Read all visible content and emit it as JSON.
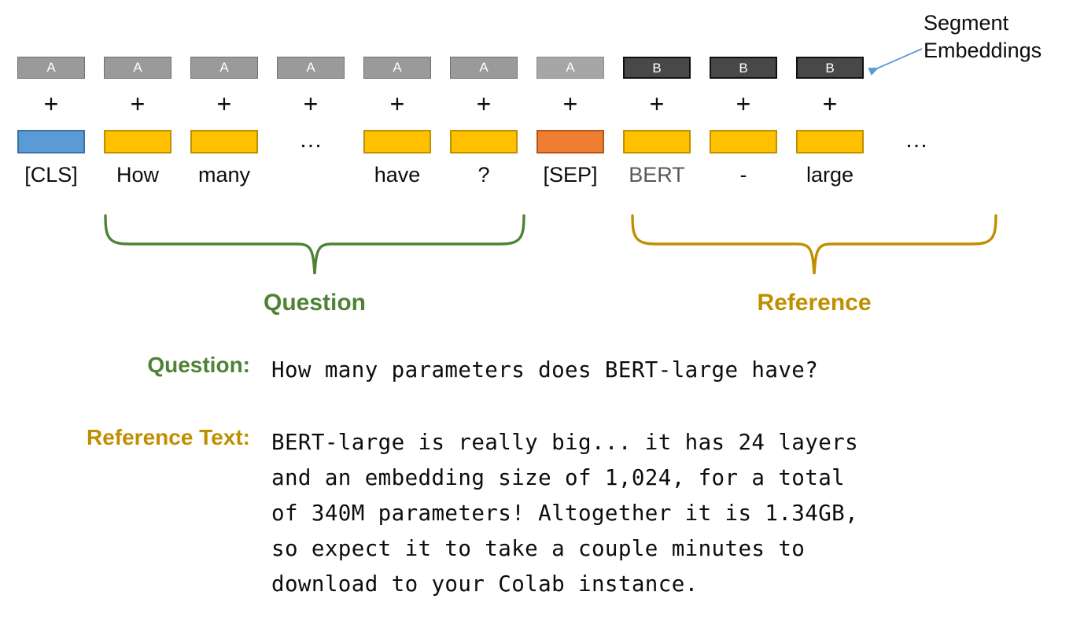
{
  "diagram": {
    "columns": [
      {
        "segment": "A",
        "segment_style": "a",
        "plus": "+",
        "embedding_color": "#5b9bd5",
        "embedding_kind": "blue",
        "token": "[CLS]",
        "token_style": "normal"
      },
      {
        "segment": "A",
        "segment_style": "a",
        "plus": "+",
        "embedding_color": "#ffc000",
        "embedding_kind": "yellow",
        "token": "How",
        "token_style": "normal"
      },
      {
        "segment": "A",
        "segment_style": "a",
        "plus": "+",
        "embedding_color": "#ffc000",
        "embedding_kind": "yellow",
        "token": "many",
        "token_style": "normal"
      },
      {
        "segment": "A",
        "segment_style": "a",
        "plus": "+",
        "embedding_color": "",
        "embedding_kind": "ellipsis",
        "token": "",
        "token_style": "normal",
        "ellipsis": "…"
      },
      {
        "segment": "A",
        "segment_style": "a",
        "plus": "+",
        "embedding_color": "#ffc000",
        "embedding_kind": "yellow",
        "token": "have",
        "token_style": "normal"
      },
      {
        "segment": "A",
        "segment_style": "a",
        "plus": "+",
        "embedding_color": "#ffc000",
        "embedding_kind": "yellow",
        "token": "?",
        "token_style": "normal"
      },
      {
        "segment": "A",
        "segment_style": "a-light",
        "plus": "+",
        "embedding_color": "#ed7d31",
        "embedding_kind": "orange",
        "token": "[SEP]",
        "token_style": "normal"
      },
      {
        "segment": "B",
        "segment_style": "b",
        "plus": "+",
        "embedding_color": "#ffc000",
        "embedding_kind": "yellow",
        "token": "BERT",
        "token_style": "muted"
      },
      {
        "segment": "B",
        "segment_style": "b",
        "plus": "+",
        "embedding_color": "#ffc000",
        "embedding_kind": "yellow",
        "token": "-",
        "token_style": "normal"
      },
      {
        "segment": "B",
        "segment_style": "b",
        "plus": "+",
        "embedding_color": "#ffc000",
        "embedding_kind": "yellow",
        "token": "large",
        "token_style": "normal"
      },
      {
        "segment": "",
        "segment_style": "none",
        "plus": "",
        "embedding_color": "",
        "embedding_kind": "ellipsis",
        "token": "",
        "token_style": "normal",
        "ellipsis": "…"
      }
    ],
    "callout": {
      "line1": "Segment",
      "line2": "Embeddings",
      "arrow_color": "#5b9bd5"
    },
    "braces": [
      {
        "label": "Question",
        "color": "#4e8234"
      },
      {
        "label": "Reference",
        "color": "#bf8f00"
      }
    ]
  },
  "text_block": {
    "question": {
      "label": "Question:",
      "label_color": "#4e8234",
      "text": "How many parameters does BERT-large have?"
    },
    "reference": {
      "label": "Reference Text:",
      "label_color": "#bf8f00",
      "lines": [
        "BERT-large is really big... it has 24 layers",
        "and an embedding size of 1,024, for a total",
        "of 340M parameters! Altogether it is 1.34GB,",
        "so expect it to take a couple minutes to",
        "download to your Colab instance."
      ]
    }
  },
  "colors": {
    "segment_a": "#9a9a9a",
    "segment_a_light": "#a6a6a6",
    "segment_b": "#484848",
    "embedding_blue": "#5b9bd5",
    "embedding_yellow": "#ffc000",
    "embedding_orange": "#ed7d31",
    "question_green": "#4e8234",
    "reference_gold": "#bf8f00",
    "muted_token": "#595959",
    "background": "#ffffff"
  }
}
